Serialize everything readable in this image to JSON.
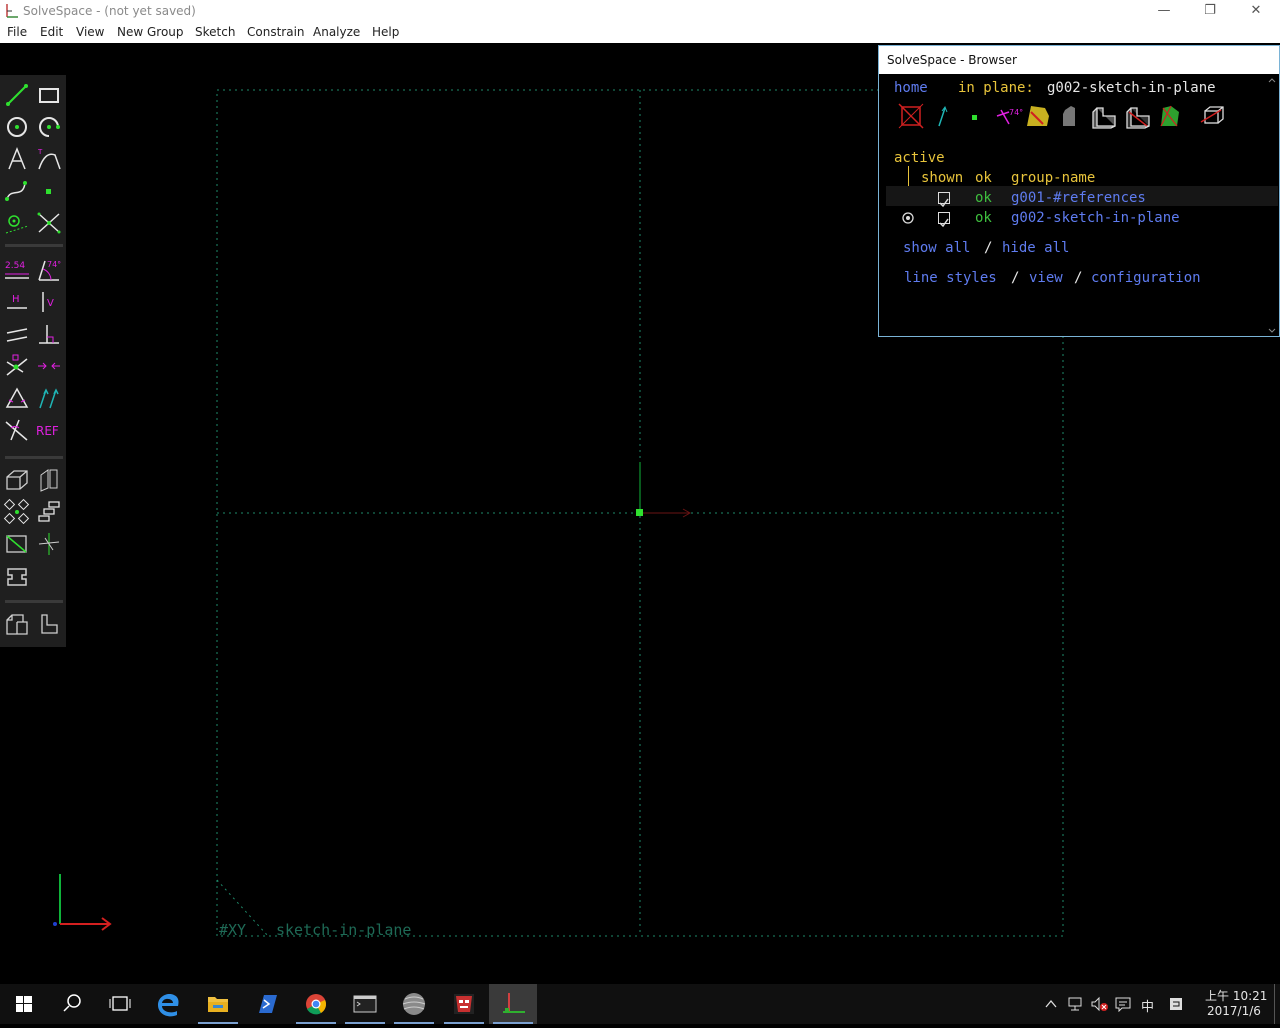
{
  "window": {
    "title": "SolveSpace - (not yet saved)",
    "minimize_glyph": "—",
    "restore_glyph": "❐",
    "close_glyph": "✕"
  },
  "menu": [
    "File",
    "Edit",
    "View",
    "New Group",
    "Sketch",
    "Constrain",
    "Analyze",
    "Help"
  ],
  "canvas": {
    "workplane_label": "#XY",
    "group_label": "sketch-in-plane",
    "colors": {
      "grid": "#1e8a6a",
      "normal": "#0fb33a",
      "point": "#2fe02f",
      "x_axis": "#d42020"
    }
  },
  "toolbar": {
    "dimension_label": "2.54",
    "angle_label": "74°",
    "horizontal_label": "H",
    "vertical_label": "V",
    "reference_label": "REF",
    "icons": [
      "line-icon",
      "rectangle-icon",
      "circle-icon",
      "arc-icon",
      "text-icon",
      "tangent-arc-icon",
      "bezier-icon",
      "point-icon",
      "construction-icon",
      "split-curves-icon",
      "distance-icon",
      "angle-icon",
      "horizontal-icon",
      "vertical-icon",
      "parallel-icon",
      "perpendicular-icon",
      "on-point-icon",
      "symmetric-icon",
      "equal-icon",
      "same-orientation-icon",
      "other-supplementary-icon",
      "reference-icon",
      "new-sketch-3d-icon",
      "new-workplane-icon",
      "step-translating-icon",
      "step-rotating-icon",
      "extrude-icon",
      "lathe-icon",
      "revolve-icon",
      "import-icon",
      "export-icon"
    ]
  },
  "browser": {
    "title": "SolveSpace - Browser",
    "nav_home": "home",
    "nav_in_plane_label": "in plane:",
    "nav_group": "g002-sketch-in-plane",
    "angle_badge": "74°",
    "section_active": "active",
    "col_shown": "shown",
    "col_ok": "ok",
    "col_group_name": "group-name",
    "groups": [
      {
        "ok": "ok",
        "name": "g001-#references",
        "active": false,
        "shown": true
      },
      {
        "ok": "ok",
        "name": "g002-sketch-in-plane",
        "active": true,
        "shown": true
      }
    ],
    "show_all": "show all",
    "hide_all": "hide all",
    "line_styles": "line styles",
    "view": "view",
    "configuration": "configuration",
    "separator": "/"
  },
  "taskbar": {
    "apps": [
      "start-icon",
      "search-icon",
      "task-view-icon",
      "edge-icon",
      "file-explorer-icon",
      "powershell-icon",
      "chrome-icon",
      "terminal-icon",
      "sphere-app-icon",
      "game-app-icon",
      "solvespace-icon"
    ],
    "ime": "中",
    "clock_time": "上午 10:21",
    "clock_date": "2017/1/6"
  }
}
